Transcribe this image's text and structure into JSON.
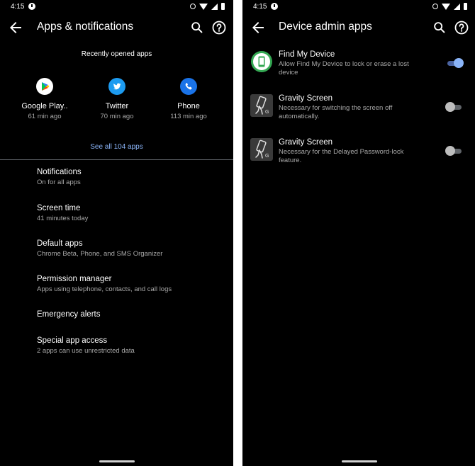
{
  "left_screen": {
    "status_time": "4:15",
    "title": "Apps & notifications",
    "recent_heading": "Recently opened apps",
    "recent_apps": [
      {
        "name": "Google Play..",
        "time": "61 min ago",
        "icon": "google-play-icon"
      },
      {
        "name": "Twitter",
        "time": "70 min ago",
        "icon": "twitter-icon"
      },
      {
        "name": "Phone",
        "time": "113 min ago",
        "icon": "phone-icon"
      }
    ],
    "see_all": "See all 104 apps",
    "settings": [
      {
        "title": "Notifications",
        "subtitle": "On for all apps"
      },
      {
        "title": "Screen time",
        "subtitle": "41 minutes today"
      },
      {
        "title": "Default apps",
        "subtitle": "Chrome Beta, Phone, and SMS Organizer"
      },
      {
        "title": "Permission manager",
        "subtitle": "Apps using telephone, contacts, and call logs"
      },
      {
        "title": "Emergency alerts",
        "subtitle": ""
      },
      {
        "title": "Special app access",
        "subtitle": "2 apps can use unrestricted data"
      }
    ]
  },
  "right_screen": {
    "status_time": "4:15",
    "title": "Device admin apps",
    "admin_apps": [
      {
        "name": "Find My Device",
        "description": "Allow Find My Device to lock or erase a lost device",
        "enabled": true,
        "icon": "find-my-device-icon"
      },
      {
        "name": "Gravity Screen",
        "description": "Necessary for switching the screen off automatically.",
        "enabled": false,
        "icon": "gravity-screen-icon"
      },
      {
        "name": "Gravity Screen",
        "description": "Necessary for the Delayed Password-lock feature.",
        "enabled": false,
        "icon": "gravity-screen-icon"
      }
    ]
  },
  "colors": {
    "background": "#000000",
    "link": "#8ab4f8",
    "toggle_on": "#8ab4f8",
    "toggle_off": "#bdbdbd",
    "twitter": "#1d9bf0",
    "phone": "#1a73e8",
    "find_my_device": "#34a853"
  }
}
